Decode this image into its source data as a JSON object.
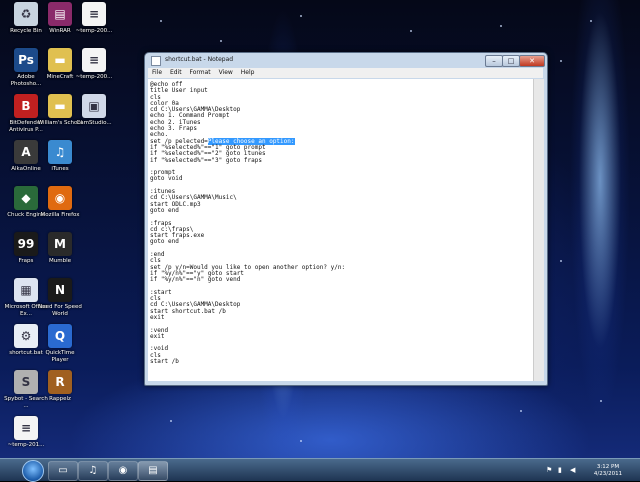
{
  "desktop": {
    "icons": [
      {
        "label": "Recycle Bin",
        "icon": "recycle-bin-icon",
        "color": "#c8d4e0",
        "glyph": "♻"
      },
      {
        "label": "WinRAR",
        "icon": "winrar-icon",
        "color": "#8a2a6a",
        "glyph": "▤"
      },
      {
        "label": "~temp-200...",
        "icon": "file-icon",
        "color": "#f4f4f4",
        "glyph": "≡"
      },
      {
        "label": "Adobe Photosho...",
        "icon": "photoshop-icon",
        "color": "#1c4a8a",
        "glyph": "Ps"
      },
      {
        "label": "MineCraft",
        "icon": "folder-icon",
        "color": "#e0c050",
        "glyph": "▬"
      },
      {
        "label": "~temp-200...",
        "icon": "file-icon",
        "color": "#f4f4f4",
        "glyph": "≡"
      },
      {
        "label": "BitDefender Antivirus P...",
        "icon": "bitdefender-icon",
        "color": "#c02020",
        "glyph": "B"
      },
      {
        "label": "William's School",
        "icon": "folder-icon",
        "color": "#e0c050",
        "glyph": "▬"
      },
      {
        "label": "CamStudio...",
        "icon": "camstudio-icon",
        "color": "#d0d8e8",
        "glyph": "▣"
      },
      {
        "label": "AlkaOnline",
        "icon": "alka-icon",
        "color": "#3a3a3a",
        "glyph": "A"
      },
      {
        "label": "iTunes",
        "icon": "itunes-icon",
        "color": "#3a8ad0",
        "glyph": "♫"
      },
      {
        "label": "Chuck Engine",
        "icon": "chuck-icon",
        "color": "#2a6a3a",
        "glyph": "◆"
      },
      {
        "label": "Mozilla Firefox",
        "icon": "firefox-icon",
        "color": "#e06a10",
        "glyph": "◉"
      },
      {
        "label": "Fraps",
        "icon": "fraps-icon",
        "color": "#1a1a1a",
        "glyph": "99"
      },
      {
        "label": "Mumble",
        "icon": "mumble-icon",
        "color": "#2a2a2a",
        "glyph": "M"
      },
      {
        "label": "Microsoft Office Ex...",
        "icon": "office-icon",
        "color": "#dde4f0",
        "glyph": "▦"
      },
      {
        "label": "Need For Speed World",
        "icon": "nfs-icon",
        "color": "#1a1a1a",
        "glyph": "N"
      },
      {
        "label": "shortcut.bat",
        "icon": "batch-file-icon",
        "color": "#e8eef6",
        "glyph": "⚙"
      },
      {
        "label": "QuickTime Player",
        "icon": "quicktime-icon",
        "color": "#2a6ad0",
        "glyph": "Q"
      },
      {
        "label": "Spybot - Search ...",
        "icon": "spybot-icon",
        "color": "#b0b0b0",
        "glyph": "S"
      },
      {
        "label": "Rappelz",
        "icon": "rappelz-icon",
        "color": "#a06020",
        "glyph": "R"
      },
      {
        "label": "~temp-201...",
        "icon": "file-icon",
        "color": "#f4f4f4",
        "glyph": "≡"
      }
    ]
  },
  "notepad": {
    "title": "shortcut.bat - Notepad",
    "controls": {
      "minimize": "–",
      "maximize": "□",
      "close": "✕"
    },
    "menu": [
      "File",
      "Edit",
      "Format",
      "View",
      "Help"
    ],
    "lines_before": "@echo off\ntitle User input\ncls\ncolor 0a\ncd C:\\Users\\GAMMA\\Desktop\necho 1. Command Prompt\necho 2. iTunes\necho 3. Fraps\necho.\nset /p pelected=",
    "selected": "Please choose an option:",
    "lines_after": "\nif \"%selected%\"==\"1\" goto prompt\nif \"%selected%\"==\"2\" goto itunes\nif \"%selected%\"==\"3\" goto fraps\n\n:prompt\ngoto void\n\n:itunes\ncd C:\\Users\\GAMMA\\Music\\\nstart ODLC.mp3\ngoto end\n\n:fraps\ncd c:\\fraps\\\nstart fraps.exe\ngoto end\n\n:end\ncls\nset /p y/n=Would you like to open another option? y/n:\nif \"%y/n%\"==\"y\" goto start\nif \"%y/n%\"==\"n\" goto vend\n\n:start\ncls\ncd C:\\Users\\GAMMA\\Desktop\nstart shortcut.bat /b\nexit\n\n:vend\nexit\n\n:void\ncls\nstart /b"
  },
  "taskbar": {
    "buttons": [
      {
        "name": "explorer",
        "glyph": "▭"
      },
      {
        "name": "itunes",
        "glyph": "♫"
      },
      {
        "name": "firefox",
        "glyph": "◉"
      },
      {
        "name": "notepad",
        "glyph": "▤"
      }
    ],
    "time": "3:12 PM",
    "date": "4/23/2011"
  }
}
